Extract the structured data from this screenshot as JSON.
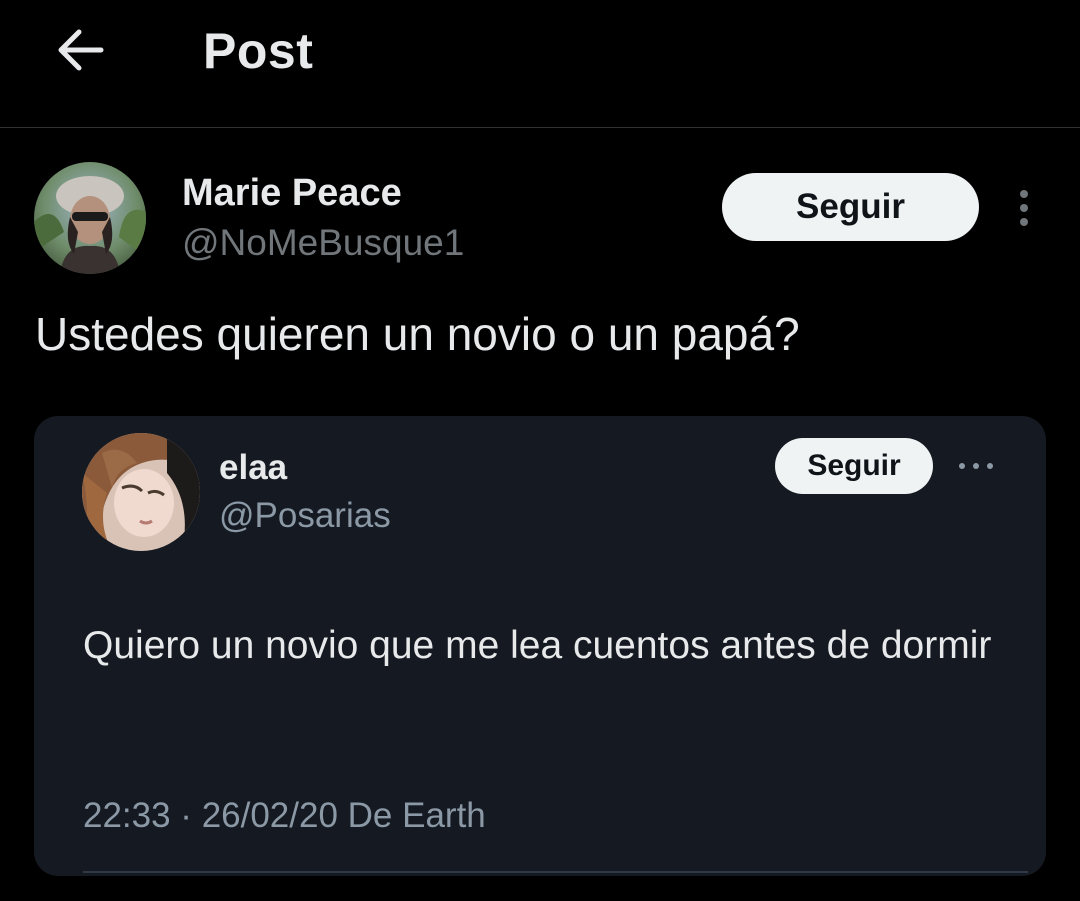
{
  "header": {
    "title": "Post",
    "back_icon": "arrow-left-icon"
  },
  "post": {
    "author": {
      "name": "Marie Peace",
      "handle": "@NoMeBusque1",
      "avatar_icon": "avatar-photo"
    },
    "follow_label": "Seguir",
    "more_icon": "more-vertical-icon",
    "text": "Ustedes quieren un novio o un papá?"
  },
  "quoted": {
    "author": {
      "name": "elaa",
      "handle": "@Posarias",
      "avatar_icon": "avatar-photo"
    },
    "follow_label": "Seguir",
    "more_icon": "more-horizontal-icon",
    "text": "Quiero un novio que me lea cuentos antes de dormir",
    "meta": "22:33 · 26/02/20 De Earth"
  },
  "colors": {
    "background": "#000000",
    "card": "#151a22",
    "primary_text": "#e7e9ea",
    "secondary_text": "#71767b",
    "button_bg": "#eff3f4",
    "button_text": "#0f1419"
  }
}
